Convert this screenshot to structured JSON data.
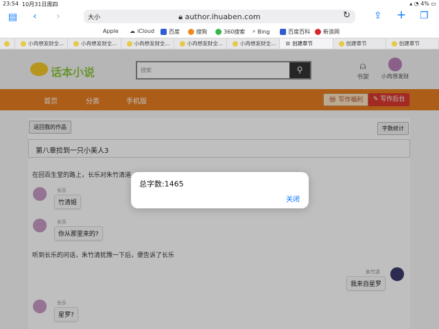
{
  "status": {
    "time": "23:54",
    "date": "10月31日周四",
    "battery": "4%"
  },
  "browser": {
    "aa_label": "大小",
    "url": "author.ihuaben.com",
    "favorites": [
      "Apple",
      "iCloud",
      "百度",
      "搜狗",
      "360搜索",
      "Bing",
      "百度百科",
      "新浪网"
    ],
    "tabs": [
      {
        "label": "小冉想发财全...",
        "active": false
      },
      {
        "label": "小冉想发财全...",
        "active": false
      },
      {
        "label": "小冉想发财全...",
        "active": false
      },
      {
        "label": "小冉想发财全...",
        "active": false
      },
      {
        "label": "小冉想发财全...",
        "active": false
      },
      {
        "label": "创建章节",
        "active": true
      },
      {
        "label": "创建章节",
        "active": false
      },
      {
        "label": "创建章节",
        "active": false
      }
    ]
  },
  "site": {
    "logo_text": "话本小说",
    "search_placeholder": "搜索",
    "shelf_label": "书架",
    "username": "小冉想发财",
    "nav": [
      "首页",
      "分类",
      "手机版"
    ],
    "nav_buttons": {
      "welfare": "写作福利",
      "backend": "写作后台"
    }
  },
  "editor": {
    "back_button": "返回我的作品",
    "word_count_button": "字数统计",
    "chapter_title": "第八章捡到一只小美人3",
    "para1": "在回百生堂的路上，长乐对朱竹清道",
    "messages": [
      {
        "name": "长乐",
        "text": "竹清姐"
      },
      {
        "name": "长乐",
        "text": "你从那里来的?"
      }
    ],
    "para2": "听到长乐的问话，朱竹清犹豫一下后，便告诉了长乐",
    "right_message": {
      "name": "朱竹清",
      "text": "我来自星罗"
    },
    "last_message": {
      "name": "长乐",
      "text": "星罗?"
    }
  },
  "dialog": {
    "message": "总字数:1465",
    "close_label": "关闭"
  }
}
